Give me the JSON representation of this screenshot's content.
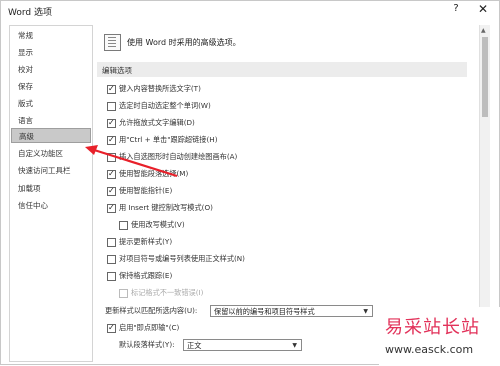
{
  "window": {
    "title": "Word 选项",
    "help_glyph": "?",
    "close_glyph": "✕"
  },
  "sidebar": {
    "items": [
      {
        "label": "常规"
      },
      {
        "label": "显示"
      },
      {
        "label": "校对"
      },
      {
        "label": "保存"
      },
      {
        "label": "版式"
      },
      {
        "label": "语言"
      },
      {
        "label": "高级"
      },
      {
        "label": "自定义功能区"
      },
      {
        "label": "快速访问工具栏"
      },
      {
        "label": "加载项"
      },
      {
        "label": "信任中心"
      }
    ],
    "selected": "高级"
  },
  "main": {
    "header": "使用 Word 时采用的高级选项。",
    "section_editing": "编辑选项",
    "options": [
      {
        "label": "键入内容替换所选文字(T)",
        "checked": true
      },
      {
        "label": "选定时自动选定整个单词(W)",
        "checked": false
      },
      {
        "label": "允许拖放式文字编辑(D)",
        "checked": true
      },
      {
        "label": "用\"Ctrl + 单击\"跟踪超链接(H)",
        "checked": true
      },
      {
        "label": "插入自选图形时自动创建绘图画布(A)",
        "checked": false
      },
      {
        "label": "使用智能段落选择(M)",
        "checked": true
      },
      {
        "label": "使用智能指针(E)",
        "checked": true
      },
      {
        "label": "用 Insert 键控制改写模式(O)",
        "checked": true
      },
      {
        "label": "使用改写模式(V)",
        "checked": false
      },
      {
        "label": "提示更新样式(Y)",
        "checked": false
      },
      {
        "label": "对项目符号或编号列表使用正文样式(N)",
        "checked": false
      },
      {
        "label": "保持格式跟踪(E)",
        "checked": false
      },
      {
        "label": "标记格式不一致错误(I)",
        "checked": false,
        "disabled": true
      }
    ],
    "update_style_label": "更新样式以匹配所选内容(U):",
    "update_style_value": "保留以前的编号和项目符号样式",
    "click_type_label": "启用\"即点即输\"(C)",
    "click_type_checked": true,
    "default_para_label": "默认段落样式(Y):",
    "default_para_value": "正文"
  },
  "watermark": {
    "cn": "易采站长站",
    "url": "www.easck.com"
  },
  "colors": {
    "annotation_arrow": "#e8202a",
    "watermark_red": "#e2325a",
    "selected_bg": "#c9c9c9"
  }
}
